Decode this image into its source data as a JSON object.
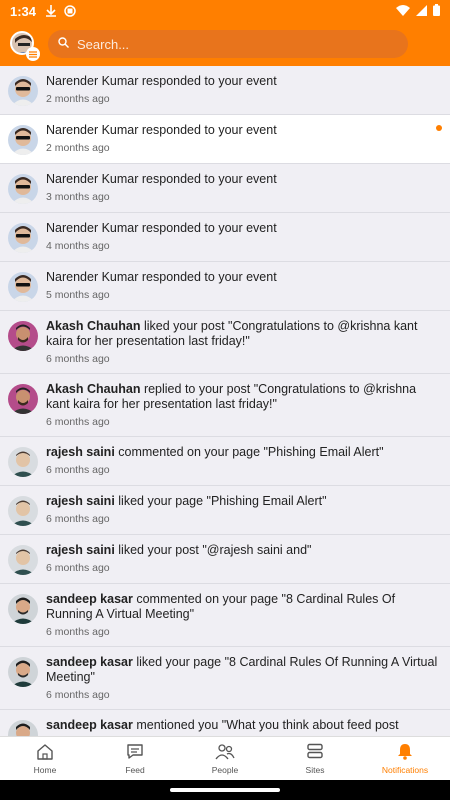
{
  "status": {
    "time": "1:34"
  },
  "search": {
    "placeholder": "Search..."
  },
  "notifications": [
    {
      "actor": "",
      "text": "Narender Kumar responded to your event",
      "time": "2 months ago",
      "unread": false,
      "avatar": "narender"
    },
    {
      "actor": "",
      "text": "Narender Kumar responded to your event",
      "time": "2 months ago",
      "unread": true,
      "avatar": "narender"
    },
    {
      "actor": "",
      "text": "Narender Kumar responded to your event",
      "time": "3 months ago",
      "unread": false,
      "avatar": "narender"
    },
    {
      "actor": "",
      "text": "Narender Kumar responded to your event",
      "time": "4 months ago",
      "unread": false,
      "avatar": "narender"
    },
    {
      "actor": "",
      "text": "Narender Kumar responded to your event",
      "time": "5 months ago",
      "unread": false,
      "avatar": "narender"
    },
    {
      "actor": "Akash Chauhan",
      "text": " liked your post \"Congratulations to @krishna kant kaira for her presentation last friday!\"",
      "time": "6 months ago",
      "unread": false,
      "avatar": "akash"
    },
    {
      "actor": "Akash Chauhan",
      "text": " replied to your post \"Congratulations to @krishna kant kaira for her presentation last friday!\"",
      "time": "6 months ago",
      "unread": false,
      "avatar": "akash"
    },
    {
      "actor": "rajesh saini",
      "text": " commented on your page \"Phishing Email Alert\"",
      "time": "6 months ago",
      "unread": false,
      "avatar": "rajesh"
    },
    {
      "actor": "rajesh saini",
      "text": " liked your page \"Phishing Email Alert\"",
      "time": "6 months ago",
      "unread": false,
      "avatar": "rajesh"
    },
    {
      "actor": "rajesh saini",
      "text": " liked your post \"@rajesh saini and\"",
      "time": "6 months ago",
      "unread": false,
      "avatar": "rajesh"
    },
    {
      "actor": "sandeep kasar",
      "text": " commented on your page \"8 Cardinal Rules Of Running A Virtual Meeting\"",
      "time": "6 months ago",
      "unread": false,
      "avatar": "sandeep"
    },
    {
      "actor": "sandeep kasar",
      "text": " liked your page \"8 Cardinal Rules Of Running A Virtual Meeting\"",
      "time": "6 months ago",
      "unread": false,
      "avatar": "sandeep"
    },
    {
      "actor": "sandeep kasar",
      "text": " mentioned you \"What you think about feed post",
      "time": "",
      "unread": false,
      "avatar": "sandeep"
    }
  ],
  "nav": [
    {
      "label": "Home",
      "icon": "home-icon",
      "active": false
    },
    {
      "label": "Feed",
      "icon": "feed-icon",
      "active": false
    },
    {
      "label": "People",
      "icon": "people-icon",
      "active": false
    },
    {
      "label": "Sites",
      "icon": "sites-icon",
      "active": false
    },
    {
      "label": "Notifications",
      "icon": "bell-icon",
      "active": true
    }
  ],
  "colors": {
    "accent": "#ff7f00",
    "unread_bg": "#ffffff",
    "read_bg": "#f0eff4"
  }
}
